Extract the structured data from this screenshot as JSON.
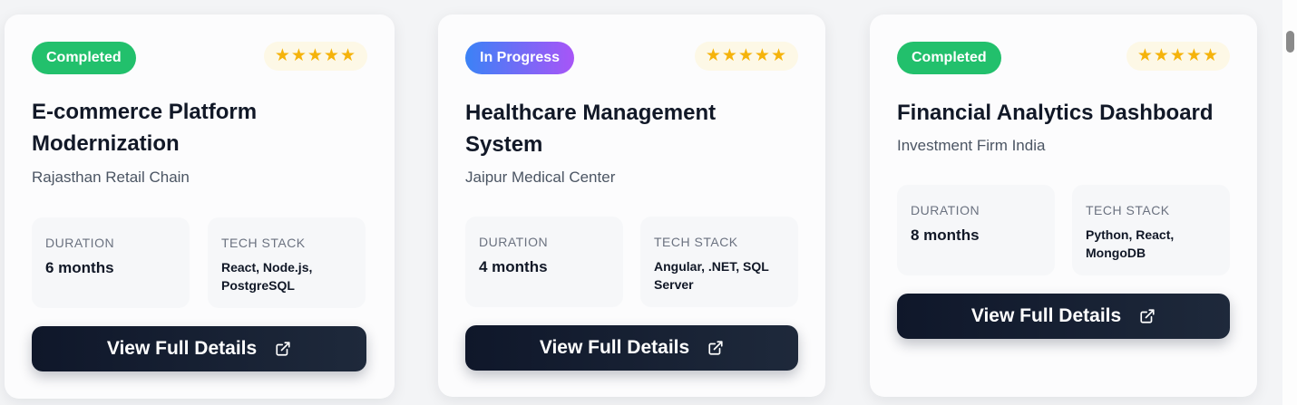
{
  "projects": [
    {
      "status": "Completed",
      "stars": "★★★★★",
      "title": "E-commerce Platform Modernization",
      "client": "Rajasthan Retail Chain",
      "duration_label": "DURATION",
      "duration": "6 months",
      "tech_label": "TECH STACK",
      "tech": "React, Node.js, PostgreSQL",
      "button": "View Full Details"
    },
    {
      "status": "In Progress",
      "stars": "★★★★★",
      "title": "Healthcare Management System",
      "client": "Jaipur Medical Center",
      "duration_label": "DURATION",
      "duration": "4 months",
      "tech_label": "TECH STACK",
      "tech": "Angular, .NET, SQL Server",
      "button": "View Full Details"
    },
    {
      "status": "Completed",
      "stars": "★★★★★",
      "title": "Financial Analytics Dashboard",
      "client": "Investment Firm India",
      "duration_label": "DURATION",
      "duration": "8 months",
      "tech_label": "TECH STACK",
      "tech": "Python, React, MongoDB",
      "button": "View Full Details"
    }
  ],
  "colors": {
    "completed": "#22c06c",
    "in_progress_start": "#3b82f6",
    "in_progress_end": "#a855f7",
    "star": "#f5b30b",
    "button": "#0f172a"
  },
  "icons": {
    "rating": "star-icon",
    "button": "external-link-icon"
  }
}
